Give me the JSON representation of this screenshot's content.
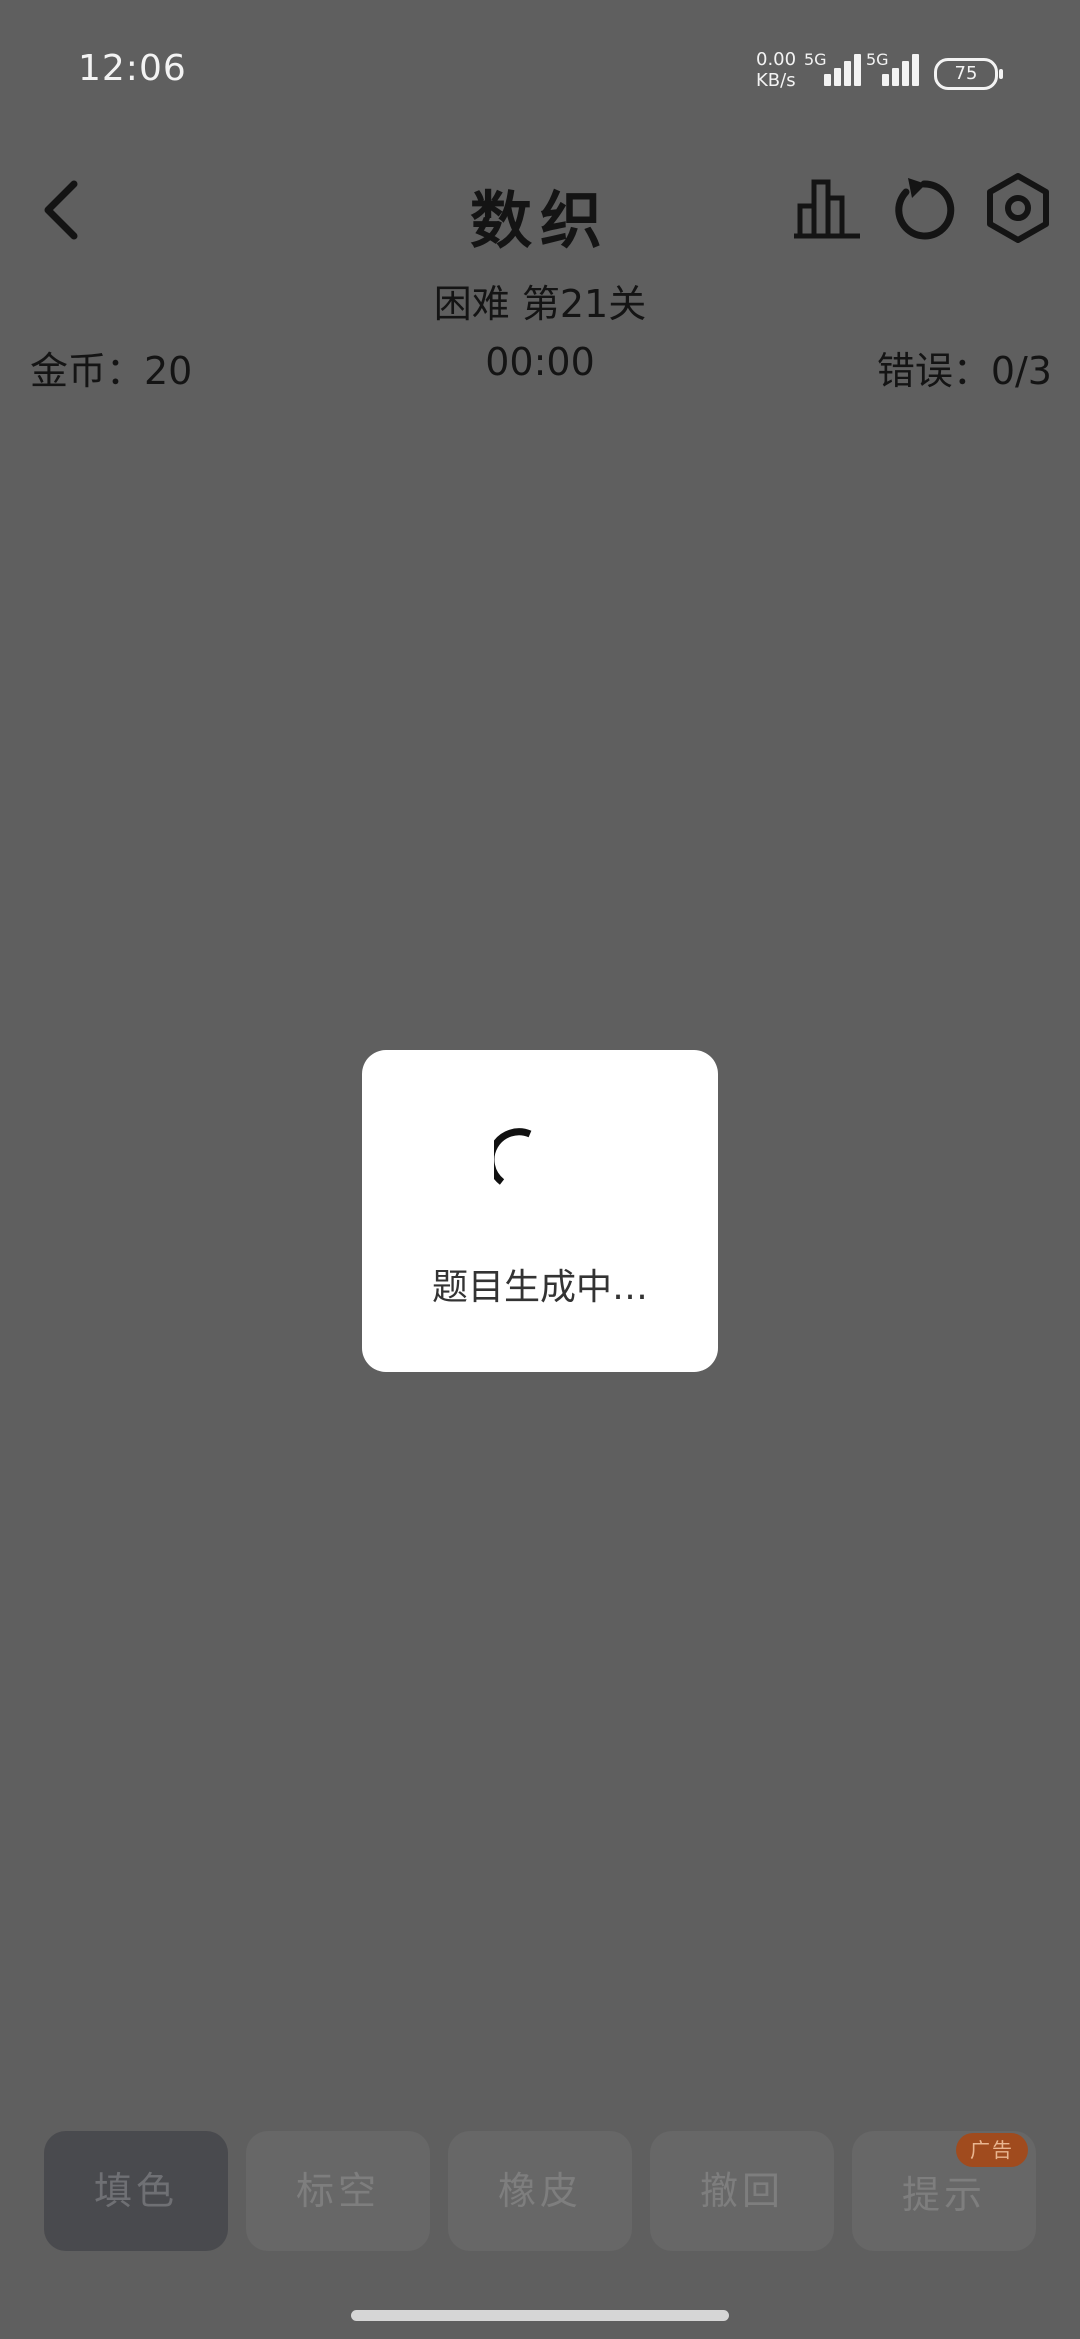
{
  "status_bar": {
    "time": "12:06",
    "net_speed_value": "0.00",
    "net_speed_unit": "KB/s",
    "signal1_label": "5G",
    "signal2_label": "5G",
    "battery": "75"
  },
  "header": {
    "title": "数织",
    "subtitle": "困难 第21关",
    "coins": "金币：20",
    "timer": "00:00",
    "errors": "错误：0/3"
  },
  "dialog": {
    "loading_text": "题目生成中…"
  },
  "toolbar": {
    "tools": [
      "填色",
      "标空",
      "橡皮",
      "撤回",
      "提示"
    ],
    "ad_badge": "广告"
  }
}
